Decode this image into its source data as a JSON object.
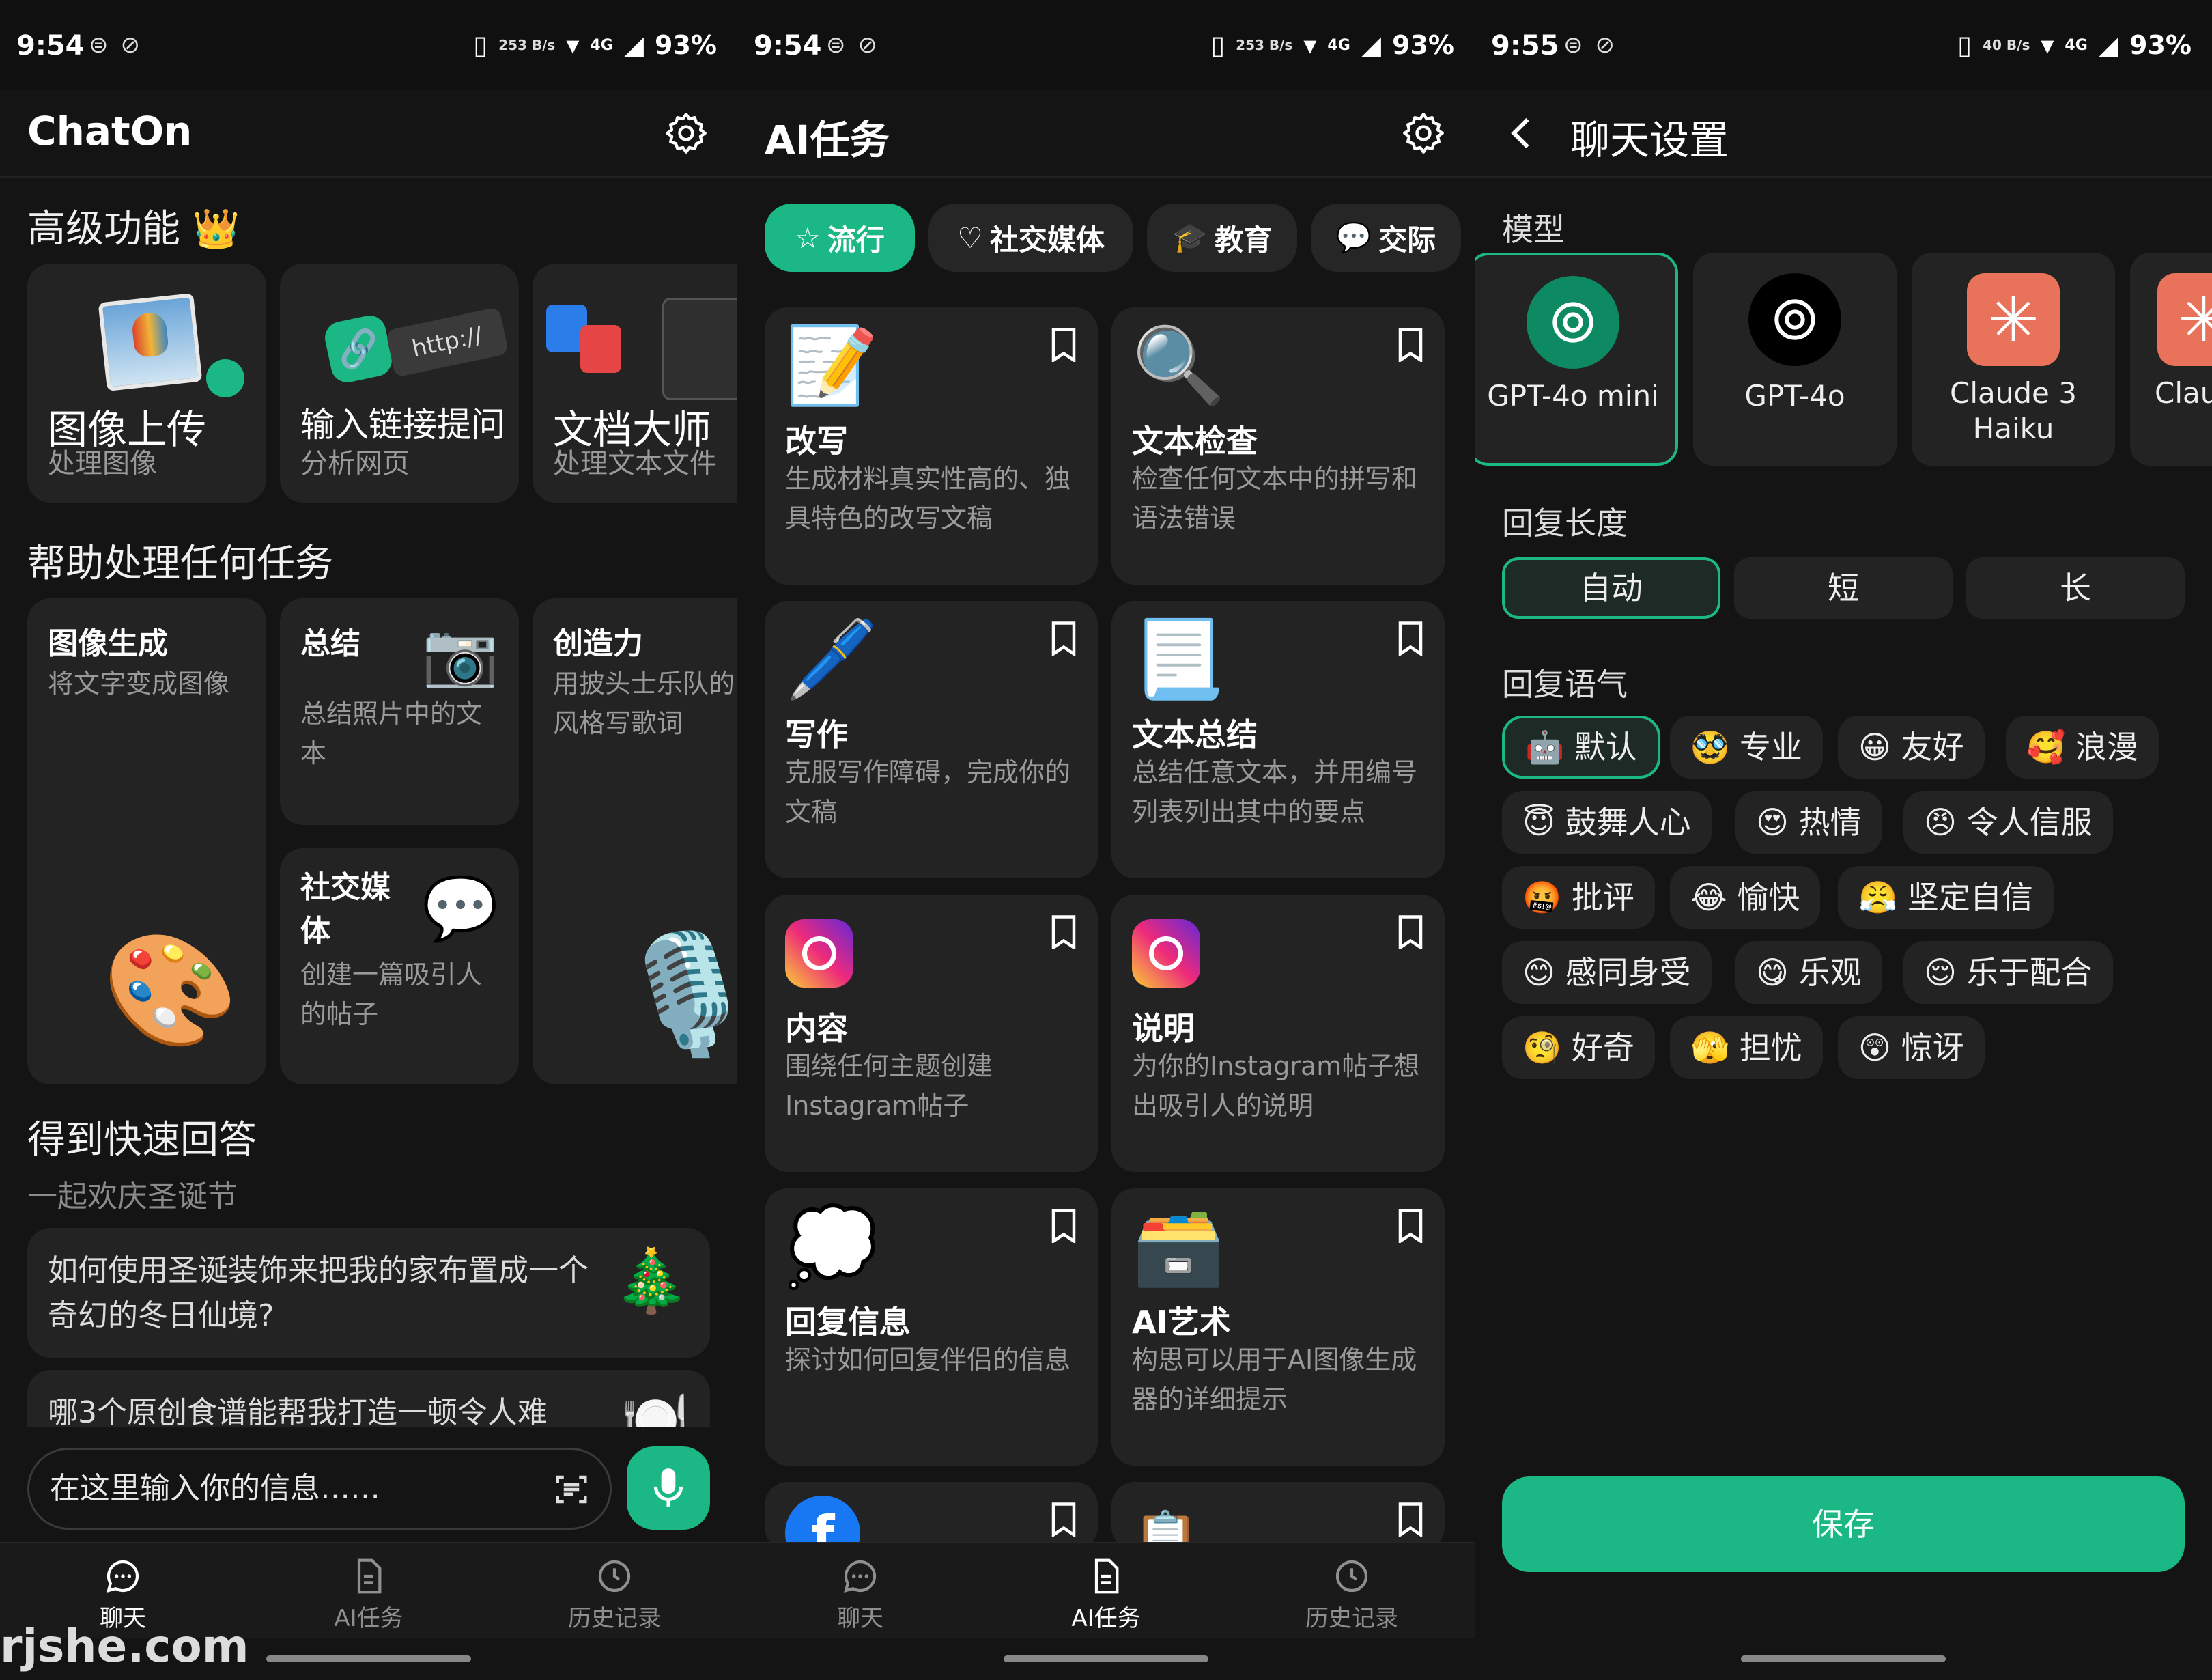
{
  "status": [
    {
      "time": "9:54",
      "net": "253\nB/s",
      "battery": "93%"
    },
    {
      "time": "9:54",
      "net": "253\nB/s",
      "battery": "93%"
    },
    {
      "time": "9:55",
      "net": "40\nB/s",
      "battery": "93%"
    }
  ],
  "status_signal": "4G",
  "chat": {
    "title": "ChatOn",
    "premium_heading": "高级功能 👑",
    "premium": [
      {
        "title": "图像上传",
        "desc": "处理图像"
      },
      {
        "title": "输入链接提问",
        "desc": "分析网页",
        "link_text": "http://"
      },
      {
        "title": "文档大师",
        "desc": "处理文本文件"
      }
    ],
    "help_heading": "帮助处理任何任务",
    "help": [
      {
        "title": "图像生成",
        "desc": "将文字变成图像",
        "icon": "🎨"
      },
      {
        "title": "总结",
        "desc": "总结照片中的文本",
        "icon": "📷"
      },
      {
        "title": "社交媒体",
        "desc": "创建一篇吸引人的帖子",
        "icon": "💬"
      },
      {
        "title": "创造力",
        "desc": "用披头士乐队的风格写歌词",
        "icon": "🎙️"
      }
    ],
    "quick_heading": "得到快速回答",
    "quick_sub": "一起欢庆圣诞节",
    "questions": [
      {
        "text": "如何使用圣诞装饰来把我的家布置成一个奇幻的冬日仙境?",
        "icon": "🎄"
      },
      {
        "text": "哪3个原创食谱能帮我打造一顿令人难",
        "icon": "🍽️"
      }
    ],
    "input_placeholder": "在这里输入你的信息……"
  },
  "nav": {
    "chat": "聊天",
    "tasks": "AI任务",
    "history": "历史记录"
  },
  "watermark": "rjshe.com",
  "tasks": {
    "title": "AI任务",
    "chips": [
      "流行",
      "社交媒体",
      "教育",
      "交际"
    ],
    "cards": [
      {
        "icon": "📝",
        "title": "改写",
        "desc": "生成材料真实性高的、独具特色的改写文稿"
      },
      {
        "icon": "🔍",
        "title": "文本检查",
        "desc": "检查任何文本中的拼写和语法错误"
      },
      {
        "icon": "🖊️",
        "title": "写作",
        "desc": "克服写作障碍，完成你的文稿"
      },
      {
        "icon": "📃",
        "title": "文本总结",
        "desc": "总结任意文本，并用编号列表列出其中的要点"
      },
      {
        "icon": "📷",
        "title": "内容",
        "desc": "围绕任何主题创建Instagram帖子"
      },
      {
        "icon": "📷",
        "title": "说明",
        "desc": "为你的Instagram帖子想出吸引人的说明"
      },
      {
        "icon": "💭",
        "title": "回复信息",
        "desc": "探讨如何回复伴侣的信息"
      },
      {
        "icon": "🗃️",
        "title": "AI艺术",
        "desc": "构思可以用于AI图像生成器的详细提示"
      }
    ]
  },
  "settings": {
    "title": "聊天设置",
    "model_label": "模型",
    "models": [
      {
        "name": "GPT-4o mini",
        "style": "green"
      },
      {
        "name": "GPT-4o",
        "style": "black"
      },
      {
        "name": "Claude 3 Haiku",
        "style": "orange"
      },
      {
        "name": "Claude Sonn",
        "style": "orange"
      }
    ],
    "length_label": "回复长度",
    "lengths": [
      "自动",
      "短",
      "长"
    ],
    "tone_label": "回复语气",
    "tones": [
      [
        "🤖 默认",
        "🥸 专业",
        "😀 友好",
        "🥰 浪漫"
      ],
      [
        "😇 鼓舞人心",
        "😍 热情",
        "😠 令人信服"
      ],
      [
        "🤬 批评",
        "😂 愉快",
        "😤 坚定自信"
      ],
      [
        "😊 感同身受",
        "😋 乐观",
        "😌 乐于配合"
      ],
      [
        "🧐 好奇",
        "🫣 担忧",
        "😲 惊讶"
      ]
    ],
    "save": "保存"
  },
  "colors": {
    "accent": "#1bb886",
    "card": "#232323",
    "background": "#141414"
  }
}
